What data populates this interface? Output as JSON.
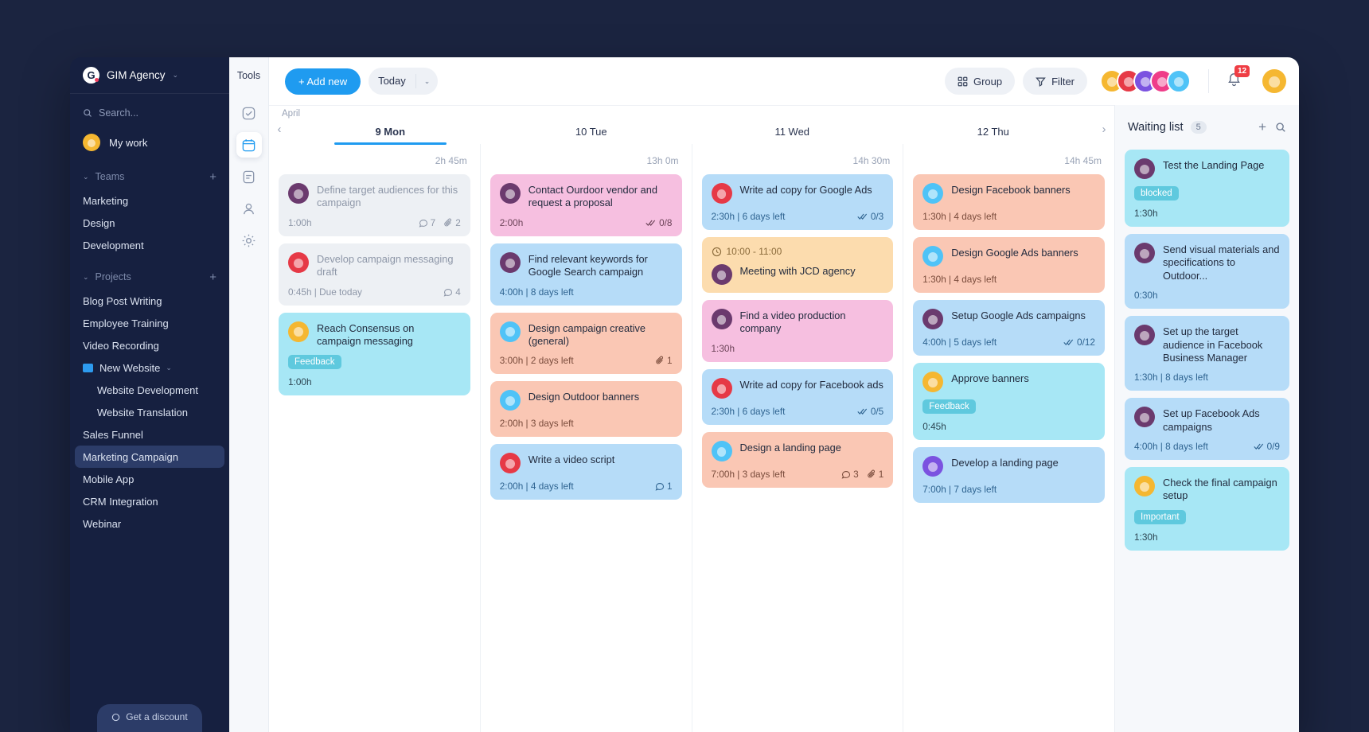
{
  "sidebar": {
    "brand": {
      "logo_letter": "G",
      "name": "GIM Agency",
      "caret": "⌄"
    },
    "search_placeholder": "Search...",
    "my_work": "My work",
    "teams_label": "Teams",
    "teams_add": "+",
    "teams": [
      "Marketing",
      "Design",
      "Development"
    ],
    "projects_label": "Projects",
    "projects_add": "+",
    "projects": [
      {
        "label": "Blog Post Writing",
        "type": "item"
      },
      {
        "label": "Employee Training",
        "type": "item"
      },
      {
        "label": "Video Recording",
        "type": "item"
      },
      {
        "label": "New Website",
        "type": "folder",
        "caret": "⌄"
      },
      {
        "label": "Website Development",
        "type": "sub"
      },
      {
        "label": "Website Translation",
        "type": "sub"
      },
      {
        "label": "Sales Funnel",
        "type": "item"
      },
      {
        "label": "Marketing Campaign",
        "type": "item",
        "active": true
      },
      {
        "label": "Mobile App",
        "type": "item"
      },
      {
        "label": "CRM Integration",
        "type": "item"
      },
      {
        "label": "Webinar",
        "type": "item"
      }
    ],
    "bottom_button": "Get a discount"
  },
  "rail": {
    "title": "Tools",
    "icons": [
      {
        "name": "tasks-icon",
        "active": false
      },
      {
        "name": "calendar-icon",
        "active": true,
        "day": "31"
      },
      {
        "name": "document-icon",
        "active": false
      },
      {
        "name": "contacts-icon",
        "active": false
      },
      {
        "name": "settings-icon",
        "active": false
      }
    ]
  },
  "topbar": {
    "add_new": "+ Add new",
    "today": "Today",
    "today_caret": "⌄",
    "group": "Group",
    "filter": "Filter",
    "avatars": [
      "av-y",
      "av-r",
      "av-p",
      "av-pk",
      "av-b"
    ],
    "notification_count": "12",
    "user_avatar": "av-y"
  },
  "calendar": {
    "month": "April",
    "prev": "‹",
    "next": "›",
    "days": [
      {
        "label": "9 Mon",
        "active": true,
        "total": "2h 45m"
      },
      {
        "label": "10 Tue",
        "active": false,
        "total": "13h 0m"
      },
      {
        "label": "11 Wed",
        "active": false,
        "total": "14h 30m"
      },
      {
        "label": "12 Thu",
        "active": false,
        "total": "14h 45m"
      }
    ],
    "columns": [
      [
        {
          "title": "Define target audiences for this campaign",
          "color": "c-gray",
          "avatar": "av-dp",
          "meta": "1:00h",
          "comments": "7",
          "attachments": "2"
        },
        {
          "title": "Develop campaign messaging draft",
          "color": "c-gray",
          "avatar": "av-r",
          "meta": "0:45h | Due today",
          "comments": "4"
        },
        {
          "title": "Reach Consensus on campaign messaging",
          "color": "c-cyan",
          "avatar": "av-y",
          "tag": "Feedback",
          "tag_class": "tag-feedback",
          "meta": "1:00h"
        }
      ],
      [
        {
          "title": "Contact Ourdoor vendor and request a proposal",
          "color": "c-pink",
          "avatar": "av-dp",
          "meta": "2:00h",
          "checklist": "0/8"
        },
        {
          "title": "Find relevant keywords for Google Search campaign",
          "color": "c-blue",
          "avatar": "av-dp",
          "meta": "4:00h | 8 days left"
        },
        {
          "title": "Design campaign creative (general)",
          "color": "c-peach",
          "avatar": "av-b",
          "meta": "3:00h | 2 days left",
          "attachments": "1"
        },
        {
          "title": "Design Outdoor banners",
          "color": "c-peach",
          "avatar": "av-b",
          "meta": "2:00h | 3 days left"
        },
        {
          "title": "Write a video script",
          "color": "c-blue",
          "avatar": "av-r",
          "meta": "2:00h | 4 days left",
          "comments": "1"
        }
      ],
      [
        {
          "title": "Write ad copy for Google Ads",
          "color": "c-blue",
          "avatar": "av-r",
          "meta": "2:30h | 6 days left",
          "checklist": "0/3"
        },
        {
          "title": "Meeting with JCD agency",
          "color": "c-orange",
          "avatar": "av-dp",
          "meeting_time": "10:00 - 11:00"
        },
        {
          "title": "Find a video production company",
          "color": "c-pink",
          "avatar": "av-dp",
          "meta": "1:30h"
        },
        {
          "title": "Write ad copy for Facebook ads",
          "color": "c-blue",
          "avatar": "av-r",
          "meta": "2:30h | 6 days left",
          "checklist": "0/5"
        },
        {
          "title": "Design a landing page",
          "color": "c-peach",
          "avatar": "av-b",
          "meta": "7:00h | 3 days left",
          "comments": "3",
          "attachments": "1"
        }
      ],
      [
        {
          "title": "Design Facebook banners",
          "color": "c-peach",
          "avatar": "av-b",
          "meta": "1:30h | 4 days left"
        },
        {
          "title": "Design Google Ads banners",
          "color": "c-peach",
          "avatar": "av-b",
          "meta": "1:30h | 4 days left"
        },
        {
          "title": "Setup Google Ads campaigns",
          "color": "c-blue",
          "avatar": "av-dp",
          "meta": "4:00h | 5 days left",
          "checklist": "0/12"
        },
        {
          "title": "Approve banners",
          "color": "c-cyan",
          "avatar": "av-y",
          "tag": "Feedback",
          "tag_class": "tag-feedback",
          "meta": "0:45h"
        },
        {
          "title": "Develop a landing page",
          "color": "c-blue",
          "avatar": "av-p",
          "meta": "7:00h | 7 days left"
        }
      ]
    ]
  },
  "waiting": {
    "title": "Waiting list",
    "count": "5",
    "add": "+",
    "search": "search-icon",
    "cards": [
      {
        "title": "Test the Landing Page",
        "color": "c-cyan",
        "avatar": "av-dp",
        "tag": "blocked",
        "tag_class": "tag-blocked",
        "meta": "1:30h"
      },
      {
        "title": "Send visual materials and specifications to Outdoor...",
        "color": "c-blue",
        "avatar": "av-dp",
        "meta": "0:30h"
      },
      {
        "title": "Set up the target audience in Facebook Business Manager",
        "color": "c-blue",
        "avatar": "av-dp",
        "meta": "1:30h | 8 days left"
      },
      {
        "title": "Set up Facebook Ads campaigns",
        "color": "c-blue",
        "avatar": "av-dp",
        "meta": "4:00h | 8 days left",
        "checklist": "0/9"
      },
      {
        "title": "Check the final campaign setup",
        "color": "c-cyan",
        "avatar": "av-y",
        "tag": "Important",
        "tag_class": "tag-important",
        "meta": "1:30h"
      }
    ]
  }
}
